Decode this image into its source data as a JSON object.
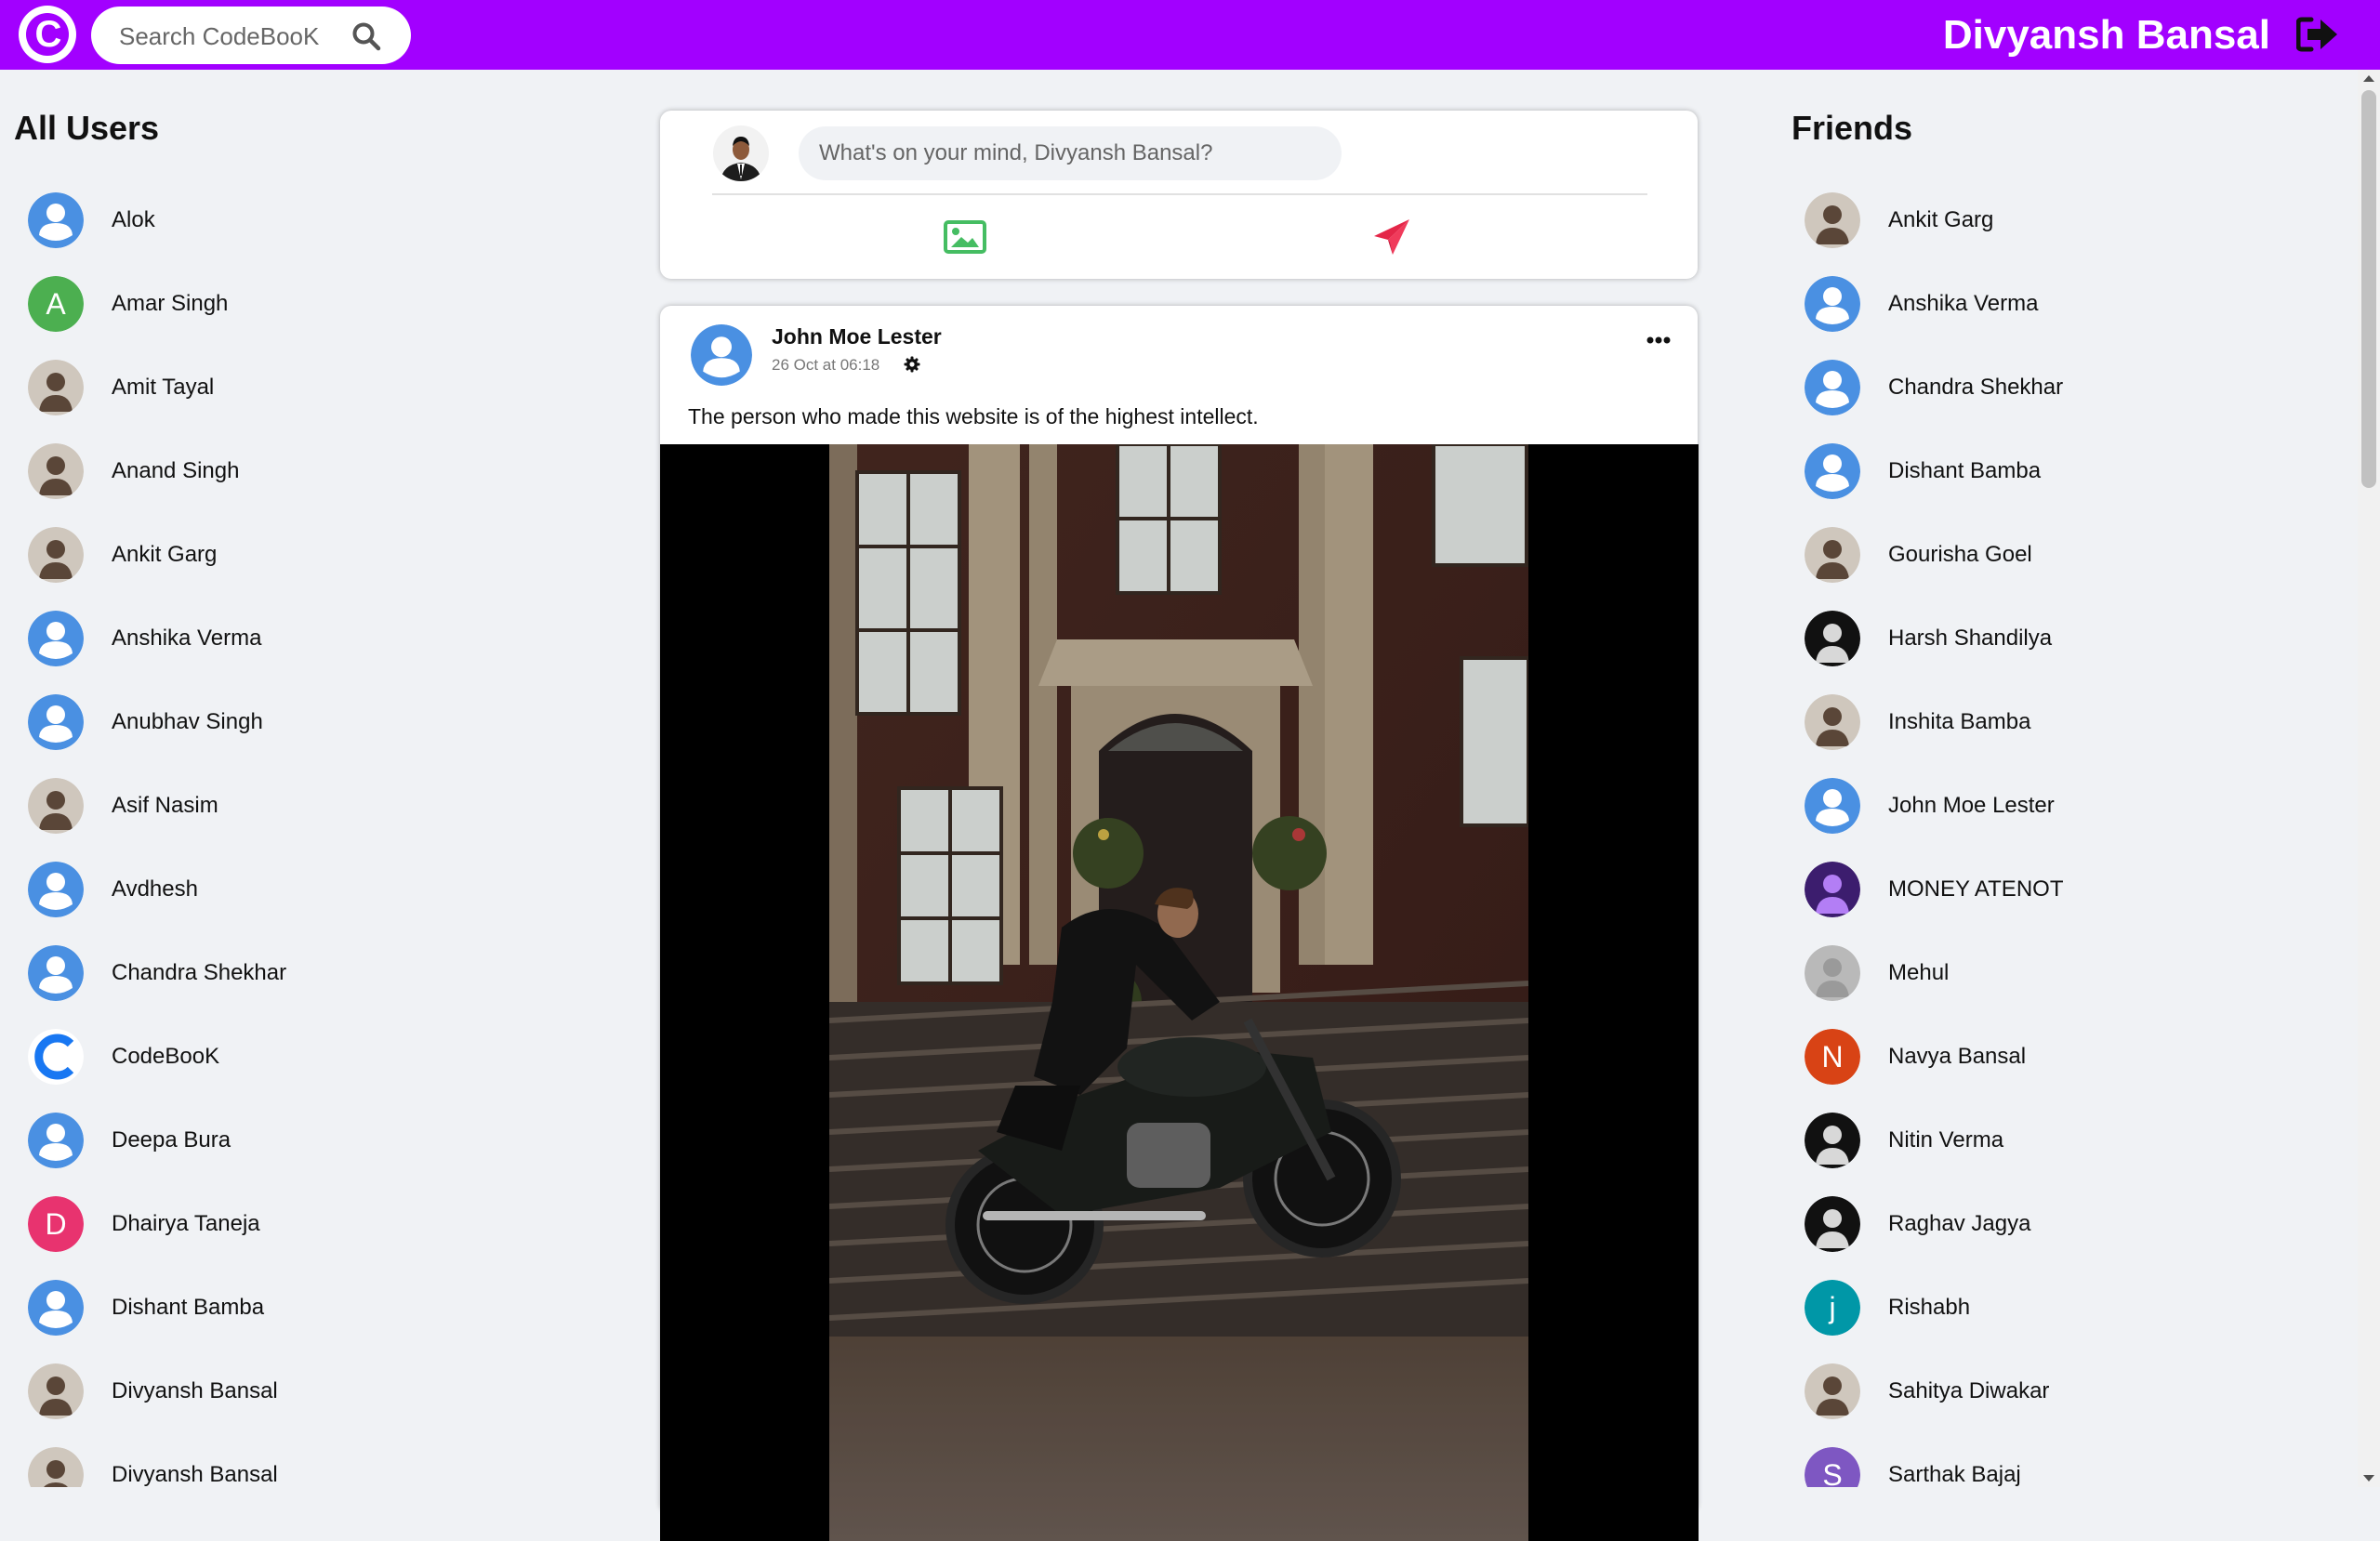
{
  "header": {
    "logo_letter": "C",
    "search_placeholder": "Search CodeBooK",
    "user_name": "Divyansh Bansal",
    "brand_color": "#a200ff"
  },
  "all_users": {
    "title": "All Users",
    "items": [
      {
        "name": "Alok",
        "avatar": "default"
      },
      {
        "name": "Amar Singh",
        "avatar": "letter",
        "letter": "A",
        "color": "#4caf50"
      },
      {
        "name": "Amit Tayal",
        "avatar": "photo"
      },
      {
        "name": "Anand Singh",
        "avatar": "photo"
      },
      {
        "name": "Ankit Garg",
        "avatar": "photo"
      },
      {
        "name": "Anshika Verma",
        "avatar": "default"
      },
      {
        "name": "Anubhav Singh",
        "avatar": "default"
      },
      {
        "name": "Asif Nasim",
        "avatar": "photo"
      },
      {
        "name": "Avdhesh",
        "avatar": "default"
      },
      {
        "name": "Chandra Shekhar",
        "avatar": "default"
      },
      {
        "name": "CodeBooK",
        "avatar": "logo"
      },
      {
        "name": "Deepa Bura",
        "avatar": "default"
      },
      {
        "name": "Dhairya Taneja",
        "avatar": "letter",
        "letter": "D",
        "color": "#e8336f"
      },
      {
        "name": "Dishant Bamba",
        "avatar": "default"
      },
      {
        "name": "Divyansh Bansal",
        "avatar": "photo"
      },
      {
        "name": "Divyansh Bansal",
        "avatar": "photo"
      }
    ]
  },
  "friends": {
    "title": "Friends",
    "items": [
      {
        "name": "Ankit Garg",
        "avatar": "photo"
      },
      {
        "name": "Anshika Verma",
        "avatar": "default"
      },
      {
        "name": "Chandra Shekhar",
        "avatar": "default"
      },
      {
        "name": "Dishant Bamba",
        "avatar": "default"
      },
      {
        "name": "Gourisha Goel",
        "avatar": "photo"
      },
      {
        "name": "Harsh Shandilya",
        "avatar": "photo-dark"
      },
      {
        "name": "Inshita Bamba",
        "avatar": "photo"
      },
      {
        "name": "John Moe Lester",
        "avatar": "default"
      },
      {
        "name": "MONEY ATENOT",
        "avatar": "photo-purple"
      },
      {
        "name": "Mehul",
        "avatar": "photo-grey"
      },
      {
        "name": "Navya Bansal",
        "avatar": "letter",
        "letter": "N",
        "color": "#d84315"
      },
      {
        "name": "Nitin Verma",
        "avatar": "photo-dark"
      },
      {
        "name": "Raghav Jagya",
        "avatar": "photo-dark"
      },
      {
        "name": "Rishabh",
        "avatar": "letter",
        "letter": "j",
        "color": "#0097a7"
      },
      {
        "name": "Sahitya Diwakar",
        "avatar": "photo"
      },
      {
        "name": "Sarthak Bajaj",
        "avatar": "letter",
        "letter": "S",
        "color": "#7e57c2"
      }
    ]
  },
  "composer": {
    "placeholder": "What's on your mind, Divyansh Bansal?"
  },
  "post": {
    "author": "John Moe Lester",
    "time": "26 Oct at 06:18",
    "text": "The person who made this website is of the highest intellect."
  }
}
